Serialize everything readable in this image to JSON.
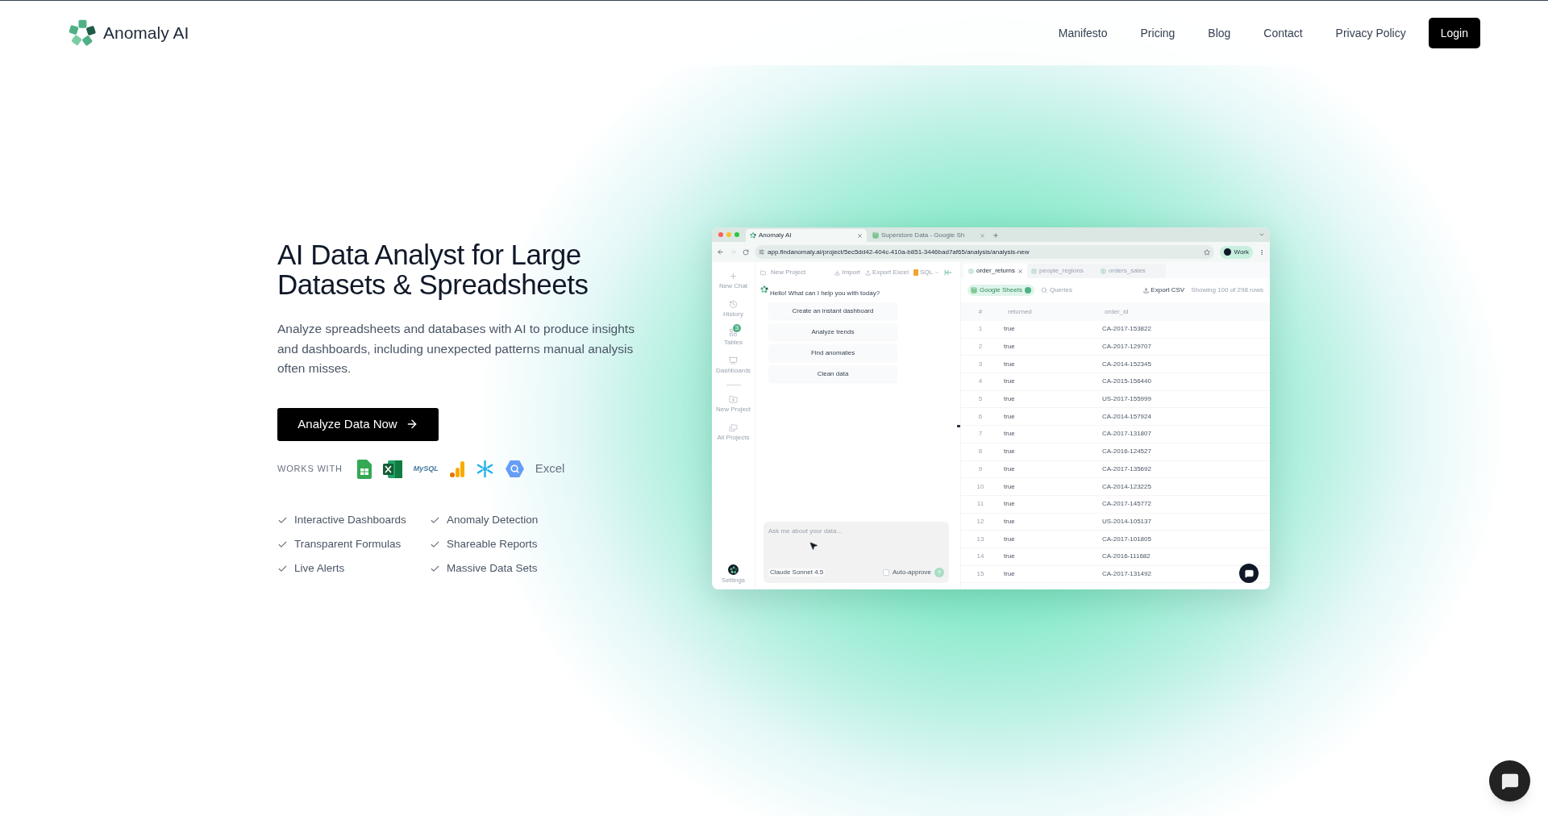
{
  "header": {
    "logo_text": "Anomaly AI",
    "nav": [
      "Manifesto",
      "Pricing",
      "Blog",
      "Contact",
      "Privacy Policy"
    ],
    "login": "Login"
  },
  "hero": {
    "title_lines": [
      "AI Data Analyst for Large",
      "Datasets & Spreadsheets"
    ],
    "description": "Analyze spreadsheets and databases with AI to produce insights and dashboards, including unexpected patterns manual analysis often misses.",
    "cta": "Analyze Data Now",
    "works_with_label": "WORKS WITH",
    "integrations": [
      {
        "kind": "sheets"
      },
      {
        "kind": "excel"
      },
      {
        "kind": "mysql",
        "label": "MySQL"
      },
      {
        "kind": "analytics"
      },
      {
        "kind": "snowflake"
      },
      {
        "kind": "bigquery"
      },
      {
        "kind": "text",
        "label": "Excel"
      }
    ],
    "features": [
      "Interactive Dashboards",
      "Anomaly Detection",
      "Transparent Formulas",
      "Shareable Reports",
      "Live Alerts",
      "Massive Data Sets"
    ]
  },
  "app_window": {
    "browser_tabs": [
      {
        "title": "Anomaly AI",
        "kind": "app",
        "selected": true
      },
      {
        "title": "Superstore Data - Google Sh",
        "kind": "sheet",
        "selected": false
      }
    ],
    "url": "app.findanomaly.ai/project/5ec5dd42-404c-410a-b851-3446bad7af65/analysis/analysis-new",
    "profile": "Work",
    "sidebar": [
      {
        "label": "New Chat",
        "kind": "plus"
      },
      {
        "label": "History",
        "kind": "history"
      },
      {
        "label": "Tables",
        "kind": "tables",
        "badge": "3"
      },
      {
        "label": "Dashboards",
        "kind": "dashboards"
      },
      {
        "label": "New Project",
        "kind": "new-project"
      },
      {
        "label": "All Projects",
        "kind": "projects"
      }
    ],
    "settings": "Settings",
    "project": "New Project",
    "actions": [
      {
        "label": "Import",
        "kind": "import"
      },
      {
        "label": "Export Excel",
        "kind": "export"
      },
      {
        "label": "SQL",
        "kind": "sql"
      }
    ],
    "greeting": "Hello! What can I help you with today?",
    "suggestions": [
      "Create an instant dashboard",
      "Analyze trends",
      "Find anomalies",
      "Clean data"
    ],
    "input_placeholder": "Ask me about your data...",
    "model": "Claude Sonnet 4.5",
    "auto_approve": {
      "label": "Auto-approve",
      "checked": false
    },
    "table_tabs": [
      {
        "label": "order_returns",
        "selected": true
      },
      {
        "label": "people_regions",
        "selected": false
      },
      {
        "label": "orders_sales",
        "selected": false
      }
    ],
    "source": "Google Sheets",
    "queries": "Queries",
    "export_csv": "Export CSV",
    "row_count": "Showing 100 of 298 rows",
    "columns": [
      "#",
      "returned",
      "order_id"
    ],
    "rows": [
      [
        "1",
        "true",
        "CA-2017-153822"
      ],
      [
        "2",
        "true",
        "CA-2017-129707"
      ],
      [
        "3",
        "true",
        "CA-2014-152345"
      ],
      [
        "4",
        "true",
        "CA-2015-156440"
      ],
      [
        "5",
        "true",
        "US-2017-155999"
      ],
      [
        "6",
        "true",
        "CA-2014-157924"
      ],
      [
        "7",
        "true",
        "CA-2017-131807"
      ],
      [
        "8",
        "true",
        "CA-2016-124527"
      ],
      [
        "9",
        "true",
        "CA-2017-135692"
      ],
      [
        "10",
        "true",
        "CA-2014-123225"
      ],
      [
        "11",
        "true",
        "CA-2017-145772"
      ],
      [
        "12",
        "true",
        "US-2014-105137"
      ],
      [
        "13",
        "true",
        "CA-2017-101805"
      ],
      [
        "14",
        "true",
        "CA-2016-111682"
      ],
      [
        "15",
        "true",
        "CA-2017-131492"
      ]
    ]
  }
}
